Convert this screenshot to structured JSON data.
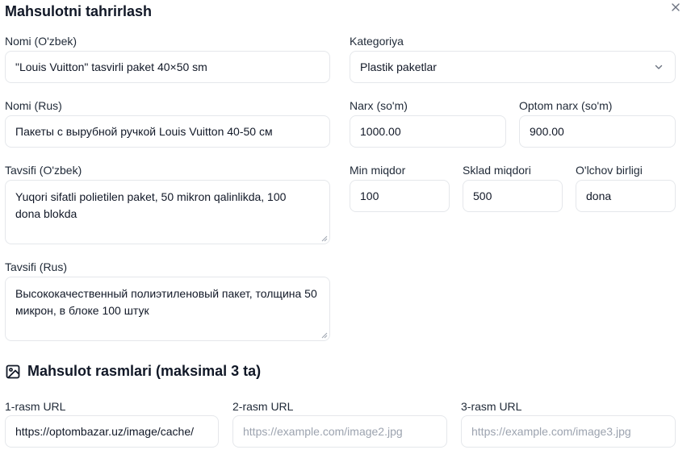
{
  "dialog": {
    "title": "Mahsulotni tahrirlash"
  },
  "name_uz": {
    "label": "Nomi (O'zbek)",
    "value": "\"Louis Vuitton\" tasvirli paket 40×50 sm"
  },
  "category": {
    "label": "Kategoriya",
    "value": "Plastik paketlar"
  },
  "name_ru": {
    "label": "Nomi (Rus)",
    "value": "Пакеты с вырубной ручкой Louis Vuitton 40-50 см"
  },
  "price": {
    "label": "Narx (so'm)",
    "value": "1000.00"
  },
  "wholesale_price": {
    "label": "Optom narx (so'm)",
    "value": "900.00"
  },
  "desc_uz": {
    "label": "Tavsifi (O'zbek)",
    "value": "Yuqori sifatli polietilen paket, 50 mikron qalinlikda, 100 dona blokda"
  },
  "min_qty": {
    "label": "Min miqdor",
    "value": "100"
  },
  "stock_qty": {
    "label": "Sklad miqdori",
    "value": "500"
  },
  "unit": {
    "label": "O'lchov birligi",
    "value": "dona"
  },
  "desc_ru": {
    "label": "Tavsifi (Rus)",
    "value": "Высококачественный полиэтиленовый пакет, толщина 50 микрон, в блоке 100 штук"
  },
  "images": {
    "title": "Mahsulot rasmlari (maksimal 3 ta)",
    "items": [
      {
        "label": "1-rasm URL",
        "value": "https://optombazar.uz/image/cache/",
        "placeholder": ""
      },
      {
        "label": "2-rasm URL",
        "value": "",
        "placeholder": "https://example.com/image2.jpg"
      },
      {
        "label": "3-rasm URL",
        "value": "",
        "placeholder": "https://example.com/image3.jpg"
      }
    ]
  },
  "icons": {
    "close": "close-icon",
    "chevron": "chevron-down-icon",
    "image": "image-icon",
    "resize": "resize-handle-icon"
  }
}
